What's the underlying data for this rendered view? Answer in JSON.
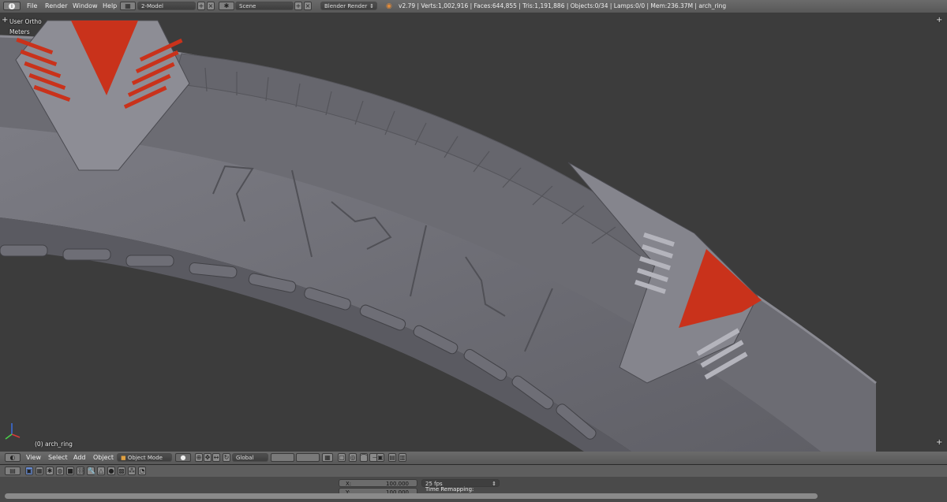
{
  "topbar": {
    "info_icon": "info-icon",
    "menu": [
      "File",
      "Render",
      "Window",
      "Help"
    ],
    "screen_layout": "2-Model",
    "scene": "Scene",
    "render_engine": "Blender Render",
    "stats": "v2.79 | Verts:1,002,916 | Faces:644,855 | Tris:1,191,886 | Objects:0/34 | Lamps:0/0 | Mem:236.37M | arch_ring"
  },
  "viewport": {
    "view_name": "User Ortho",
    "units": "Meters",
    "object_label": "(0) arch_ring",
    "accent_color": "#c9321b",
    "mesh_color": "#707078"
  },
  "header3d": {
    "menus": [
      "View",
      "Select",
      "Add",
      "Object"
    ],
    "mode": "Object Mode",
    "orientation": "Global"
  },
  "timeline": {
    "x_label": "X:",
    "x_value": "100.000",
    "y_label": "Y:",
    "y_value": "100.000",
    "fps": "25 fps",
    "remap": "Time Remapping:"
  }
}
